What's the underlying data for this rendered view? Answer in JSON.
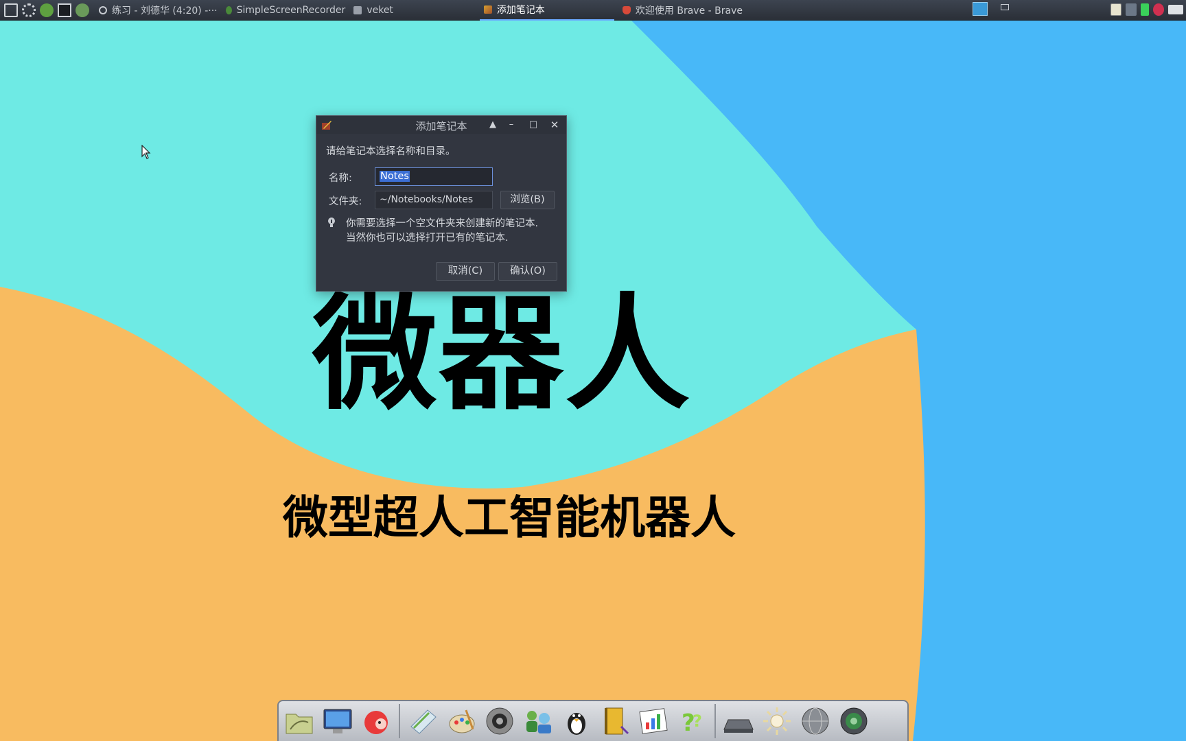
{
  "taskbar": {
    "tasks": [
      {
        "label": "练习 - 刘德华 (4:20) -···",
        "color": "#c8ccd2"
      },
      {
        "label": "SimpleScreenRecorder",
        "color": "#5a9a3a"
      },
      {
        "label": "veket",
        "color": "#9aa0aa"
      },
      {
        "label": "添加笔记本",
        "color": "#d8a030"
      },
      {
        "label": "欢迎使用 Brave - Brave",
        "color": "#d84a3a"
      }
    ]
  },
  "desktop": {
    "title": "微器人",
    "subtitle": "微型超人工智能机器人",
    "colors": {
      "cyan": "#6eeae4",
      "orange": "#f8bb60",
      "blue": "#48b8f8"
    }
  },
  "dialog": {
    "title": "添加笔记本",
    "prompt": "请给笔记本选择名称和目录。",
    "name_label": "名称:",
    "name_value": "Notes",
    "folder_label": "文件夹:",
    "folder_value": "~/Notebooks/Notes",
    "browse_label": "浏览(B)",
    "hint_line1": "你需要选择一个空文件夹来创建新的笔记本.",
    "hint_line2": "当然你也可以选择打开已有的笔记本.",
    "cancel_label": "取消(C)",
    "ok_label": "确认(O)"
  },
  "dock": {
    "icons": [
      "folder-icon",
      "monitor-icon",
      "pet-icon",
      "notepad-icon",
      "paint-icon",
      "speaker-icon",
      "users-icon",
      "penguin-icon",
      "notebook-icon",
      "chart-icon",
      "help-icon",
      "drive-icon",
      "sun-icon",
      "globe-icon",
      "camera-icon"
    ]
  }
}
